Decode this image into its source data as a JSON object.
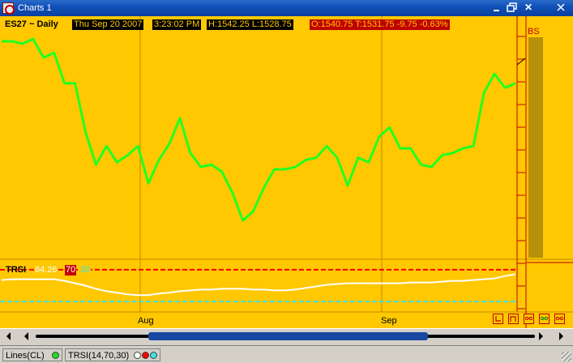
{
  "window": {
    "title": "Charts 1",
    "minimize_icon": "minimize-icon",
    "restore_icon": "restore-icon",
    "close_glyph": "✕"
  },
  "header": {
    "symbol": "ES27 ~ Daily",
    "date": "Thu Sep 20 2007",
    "time": "3:23:02 PM",
    "high_low": "H:1542.25  L:1528.75",
    "open_last_change": "O:1540.75  T:1531.75  -9.75  -0.63%"
  },
  "indicator": {
    "name": "TRSI",
    "value": "64.26",
    "overbought": "70",
    "oversold": "30"
  },
  "axis": {
    "months": [
      "Aug",
      "Sep"
    ]
  },
  "side_panel": {
    "label": "BS"
  },
  "chart_data": {
    "type": "line",
    "series": [
      {
        "values": [
          1496,
          1496,
          1495,
          1497,
          1489,
          1491,
          1478,
          1478,
          1457,
          1443,
          1451,
          1444,
          1447,
          1451,
          1435,
          1445,
          1452,
          1463,
          1448,
          1442,
          1443,
          1440,
          1431,
          1419,
          1423,
          1433,
          1441,
          1441,
          1442,
          1445,
          1446,
          1451,
          1446,
          1434,
          1446,
          1444,
          1455,
          1459,
          1450,
          1450,
          1443,
          1442,
          1447,
          1448,
          1450,
          1451,
          1474,
          1482,
          1476,
          1478
        ]
      },
      {
        "name": "TRSI",
        "values": [
          57,
          58,
          58,
          58,
          58,
          58,
          56,
          53,
          50,
          46,
          43,
          41,
          39,
          38,
          38,
          40,
          41,
          43,
          44,
          45,
          45,
          46,
          46,
          46,
          45,
          45,
          44,
          44,
          45,
          47,
          49,
          51,
          52,
          53,
          53,
          53,
          53,
          53,
          53,
          54,
          54,
          54,
          55,
          56,
          56,
          57,
          58,
          59,
          62,
          64.26
        ]
      }
    ],
    "levels": {
      "overbought": 70,
      "oversold": 30
    },
    "colors": {
      "price": "#22ff22",
      "indicator": "#ffffff",
      "overbought": "#ff0000",
      "oversold": "#40e0e0",
      "background": "#ffc800",
      "grid": "#c08a00"
    }
  },
  "scrollbar": {
    "position": 0.45
  },
  "status_bar": {
    "lines_label": "Lines(CL)",
    "trsi_label": "TRSI(14,70,30)",
    "dot_colors": [
      "#22dd22",
      "#ffffff",
      "#ff0000",
      "#40e0e0"
    ]
  },
  "toolbar_icons": [
    "step-back-icon",
    "square-icon",
    "scissors-icon",
    "scissors-green-icon",
    "scissors-red-icon"
  ]
}
